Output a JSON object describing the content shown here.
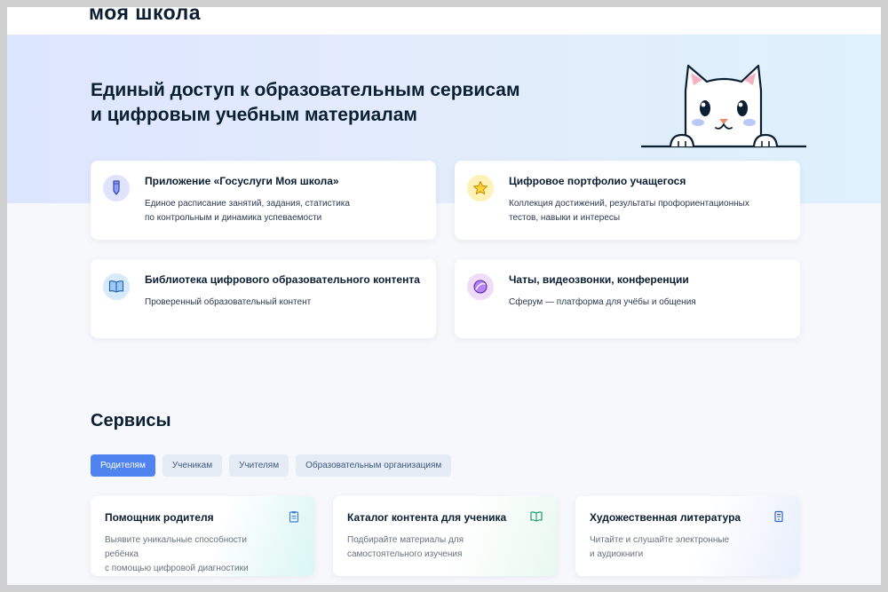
{
  "header": {
    "logo": "моя школа"
  },
  "hero": {
    "title_line1": "Единый доступ к образовательным сервисам",
    "title_line2": "и цифровым учебным материалам"
  },
  "features": [
    {
      "title": "Приложение «Госуслуги Моя школа»",
      "desc_line1": "Единое расписание занятий, задания, статистика",
      "desc_line2": "по контрольным и динамика успеваемости",
      "icon": "pencil-icon",
      "icon_bg": "#dfe3fb"
    },
    {
      "title": "Цифровое портфолио учащегося",
      "desc_line1": "Коллекция достижений, результаты профориентационных",
      "desc_line2": "тестов, навыки и интересы",
      "icon": "star-icon",
      "icon_bg": "#fff2b8"
    },
    {
      "title": "Библиотека цифрового образовательного контента",
      "desc_line1": "Проверенный образовательный контент",
      "desc_line2": "",
      "icon": "book-icon",
      "icon_bg": "#d7eafc"
    },
    {
      "title": "Чаты, видеозвонки, конференции",
      "desc_line1": "Сферум — платформа для учёбы и общения",
      "desc_line2": "",
      "icon": "chat-sphere-icon",
      "icon_bg": "#efdcf9"
    }
  ],
  "services": {
    "title": "Сервисы",
    "tabs": [
      "Родителям",
      "Ученикам",
      "Учителям",
      "Образовательным организациям"
    ],
    "active_tab": "Родителям",
    "cards": [
      {
        "title": "Помощник родителя",
        "desc_line1": "Выявите уникальные способности ребёнка",
        "desc_line2": "с помощью цифровой диагностики",
        "icon": "clipboard-icon"
      },
      {
        "title": "Каталог контента для ученика",
        "desc_line1": "Подбирайте материалы для",
        "desc_line2": "самостоятельного изучения",
        "icon": "open-book-icon"
      },
      {
        "title": "Художественная литература",
        "desc_line1": "Читайте и слушайте электронные",
        "desc_line2": "и аудиокниги",
        "icon": "ebook-icon"
      }
    ]
  },
  "colors": {
    "accent": "#4f83f0",
    "text": "#0b1f33",
    "tab_bg": "#e6ecf6",
    "hero_gradient_start": "#dde6ff",
    "hero_gradient_end": "#def1fc"
  }
}
